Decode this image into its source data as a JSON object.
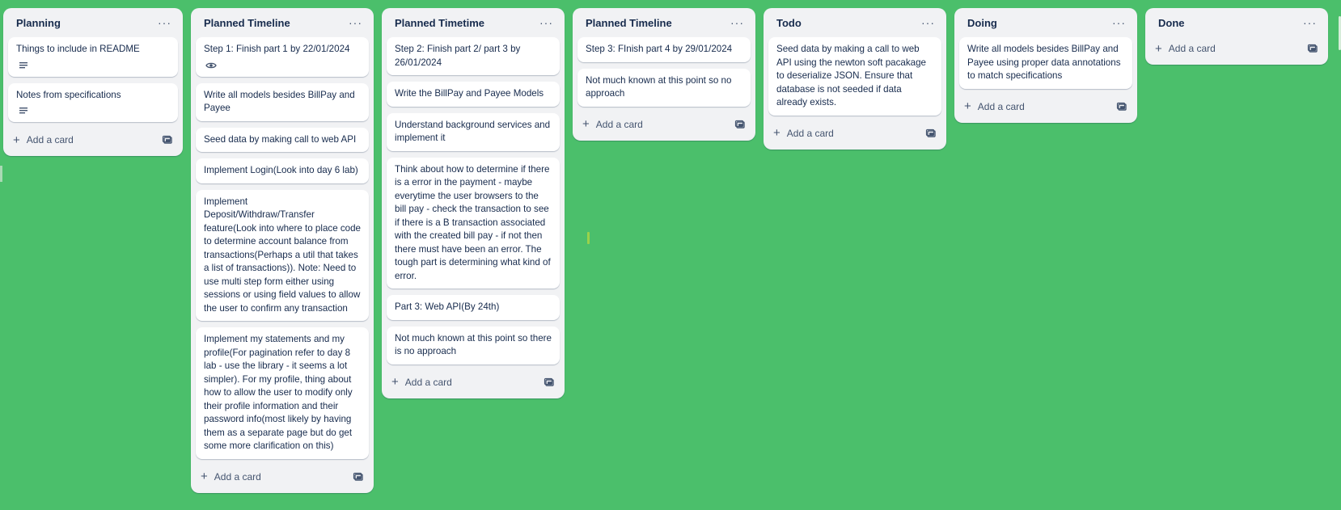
{
  "board": {
    "lists": [
      {
        "title": "Planning",
        "cards": [
          {
            "text": "Things to include in README",
            "badge": "description-icon"
          },
          {
            "text": "Notes from specifications",
            "badge": "description-icon"
          }
        ],
        "add_label": "Add a card"
      },
      {
        "title": "Planned Timeline",
        "cards": [
          {
            "text": "Step 1: Finish part 1 by 22/01/2024",
            "badge": "eye-icon"
          },
          {
            "text": "Write all models besides BillPay and Payee"
          },
          {
            "text": "Seed data by making call to web API"
          },
          {
            "text": "Implement Login(Look into day 6 lab)"
          },
          {
            "text": "Implement Deposit/Withdraw/Transfer feature(Look into where to place code to determine account balance from transactions(Perhaps a util that takes a list of transactions)). Note: Need to use multi step form either using sessions or using field values to allow the user to confirm any transaction"
          },
          {
            "text": "Implement my statements and my profile(For pagination refer to day 8 lab - use the library - it seems a lot simpler). For my profile, thing about how to allow the user to modify only their profile information and their password info(most likely by having them as a separate page but do get some more clarification on this)"
          }
        ],
        "add_label": "Add a card"
      },
      {
        "title": "Planned Timetime",
        "cards": [
          {
            "text": "Step 2: Finish part 2/ part 3 by 26/01/2024"
          },
          {
            "text": "Write the BillPay and Payee Models"
          },
          {
            "text": "Understand background services and implement it"
          },
          {
            "text": "Think about how to determine if there is a error in the payment - maybe everytime the user browsers to the bill pay - check the transaction to see if there is a B transaction associated with the created bill pay - if not then there must have been an error. The tough part is determining what kind of error."
          },
          {
            "text": "Part 3: Web API(By 24th)"
          },
          {
            "text": "Not much known at this point so there is no approach"
          }
        ],
        "add_label": "Add a card"
      },
      {
        "title": "Planned Timeline",
        "cards": [
          {
            "text": "Step 3: FInish part 4 by 29/01/2024"
          },
          {
            "text": "Not much known at this point so no approach"
          }
        ],
        "add_label": "Add a card"
      },
      {
        "title": "Todo",
        "cards": [
          {
            "text": "Seed data by making a call to web API using the newton soft pacakage to deserialize JSON. Ensure that database is not seeded if data already exists."
          }
        ],
        "add_label": "Add a card"
      },
      {
        "title": "Doing",
        "cards": [
          {
            "text": "Write all models besides BillPay and Payee using proper data annotations to match specifications"
          }
        ],
        "add_label": "Add a card"
      },
      {
        "title": "Done",
        "cards": [],
        "add_label": "Add a card"
      }
    ],
    "menu_glyph": "···",
    "background_color": "#4bbf6b"
  }
}
